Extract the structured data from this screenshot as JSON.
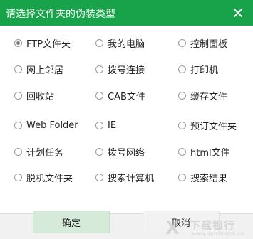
{
  "dialog": {
    "title": "请选择文件夹的伪装类型",
    "options": [
      {
        "label": "FTP文件夹",
        "checked": true
      },
      {
        "label": "我的电脑",
        "checked": false
      },
      {
        "label": "控制面板",
        "checked": false
      },
      {
        "label": "网上邻居",
        "checked": false
      },
      {
        "label": "拨号连接",
        "checked": false
      },
      {
        "label": "打印机",
        "checked": false
      },
      {
        "label": "回收站",
        "checked": false
      },
      {
        "label": "CAB文件",
        "checked": false
      },
      {
        "label": "缓存文件",
        "checked": false
      },
      {
        "label": "Web Folder",
        "checked": false
      },
      {
        "label": "IE",
        "checked": false
      },
      {
        "label": "预订文件夹",
        "checked": false
      },
      {
        "label": "计划任务",
        "checked": false
      },
      {
        "label": "拨号网络",
        "checked": false
      },
      {
        "label": "html文件",
        "checked": false
      },
      {
        "label": "脱机文件夹",
        "checked": false
      },
      {
        "label": "搜索计算机",
        "checked": false
      },
      {
        "label": "搜索结果",
        "checked": false
      }
    ],
    "ok_label": "确定",
    "cancel_label": "取消"
  },
  "watermark": {
    "name": "下载银行",
    "url": "www.downbank.cn"
  },
  "colors": {
    "titlebar": "#18a34a",
    "ok_button": "#d5ead8",
    "cancel_button": "#f2f2f2"
  }
}
